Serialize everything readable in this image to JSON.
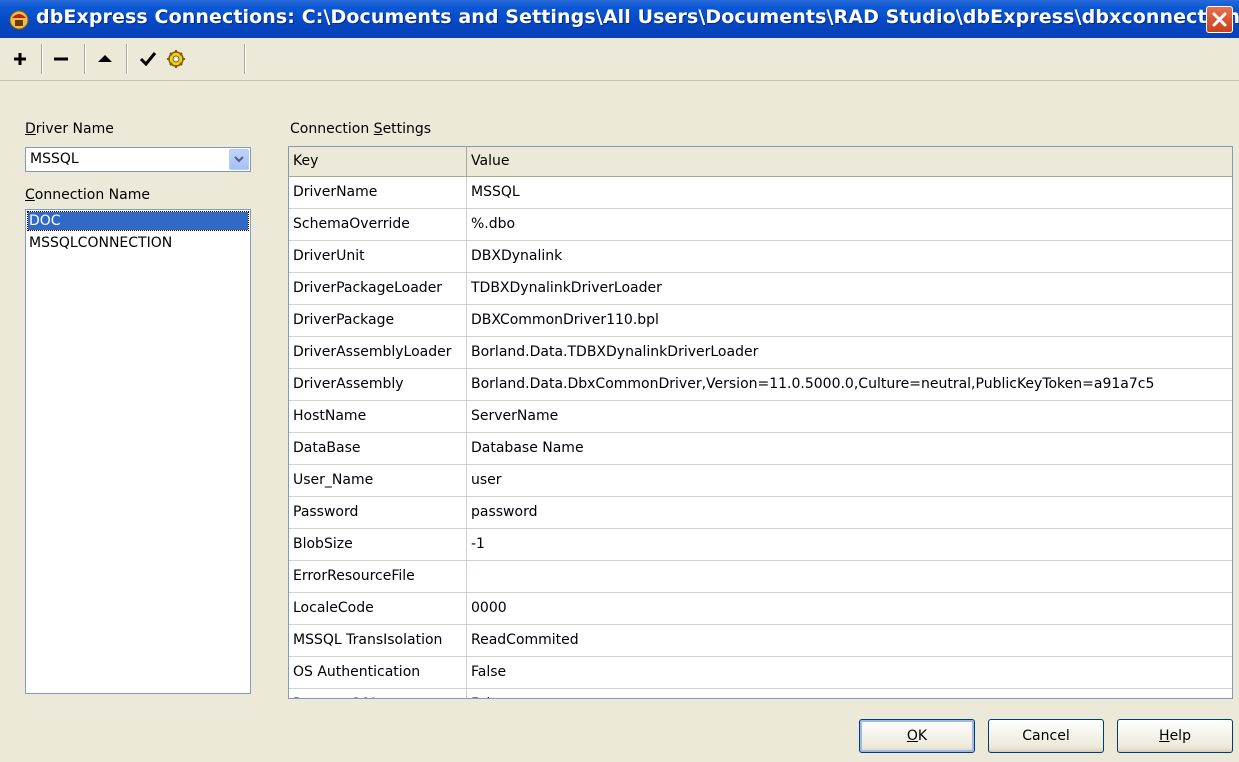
{
  "window": {
    "title": "dbExpress Connections: C:\\Documents and Settings\\All Users\\Documents\\RAD Studio\\dbExpress\\dbxconnections.ini",
    "icon": "app-icon",
    "close_icon": "close-icon"
  },
  "toolbar": {
    "buttons": [
      {
        "icon": "add-icon"
      },
      {
        "icon": "remove-icon"
      },
      {
        "icon": "rename-icon"
      },
      {
        "icon": "test-connection-icon"
      },
      {
        "icon": "options-icon"
      }
    ]
  },
  "driver": {
    "label_underline": "D",
    "label_rest": "river Name",
    "value": "MSSQL"
  },
  "connections": {
    "label_underline": "C",
    "label_rest": "onnection Name",
    "items": [
      "DOC",
      "MSSQLCONNECTION"
    ],
    "selected": "DOC"
  },
  "settings": {
    "label_prefix": "Connection ",
    "label_underline": "S",
    "label_rest": "ettings",
    "columns": [
      "Key",
      "Value"
    ],
    "rows": [
      {
        "key": "DriverName",
        "value": "MSSQL"
      },
      {
        "key": "SchemaOverride",
        "value": "%.dbo"
      },
      {
        "key": "DriverUnit",
        "value": "DBXDynalink"
      },
      {
        "key": "DriverPackageLoader",
        "value": "TDBXDynalinkDriverLoader"
      },
      {
        "key": "DriverPackage",
        "value": "DBXCommonDriver110.bpl"
      },
      {
        "key": "DriverAssemblyLoader",
        "value": "Borland.Data.TDBXDynalinkDriverLoader"
      },
      {
        "key": "DriverAssembly",
        "value": "Borland.Data.DbxCommonDriver,Version=11.0.5000.0,Culture=neutral,PublicKeyToken=a91a7c5"
      },
      {
        "key": "HostName",
        "value": "ServerName"
      },
      {
        "key": "DataBase",
        "value": "Database Name"
      },
      {
        "key": "User_Name",
        "value": "user"
      },
      {
        "key": "Password",
        "value": "password"
      },
      {
        "key": "BlobSize",
        "value": "-1"
      },
      {
        "key": "ErrorResourceFile",
        "value": ""
      },
      {
        "key": "LocaleCode",
        "value": "0000"
      },
      {
        "key": "MSSQL TransIsolation",
        "value": "ReadCommited"
      },
      {
        "key": "OS Authentication",
        "value": "False"
      },
      {
        "key": "Prepare SQL",
        "value": "False"
      }
    ]
  },
  "buttons": {
    "ok_underline": "O",
    "ok_rest": "K",
    "cancel": "Cancel",
    "help_underline": "H",
    "help_rest": "elp"
  }
}
